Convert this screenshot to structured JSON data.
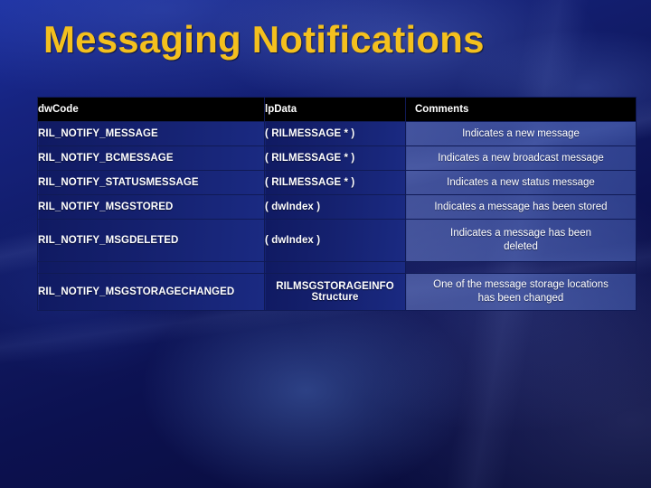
{
  "slide": {
    "title": "Messaging Notifications",
    "title_color": "#f4c01e",
    "background_color": "#0d1057"
  },
  "table": {
    "headers": {
      "col1": "dwCode",
      "col2": "lpData",
      "col3": "Comments"
    },
    "rows": [
      {
        "code": "RIL_NOTIFY_MESSAGE",
        "data": "( RILMESSAGE * )",
        "comment_line1": "Indicates a new message",
        "comment_line2": ""
      },
      {
        "code": "RIL_NOTIFY_BCMESSAGE",
        "data": "( RILMESSAGE * )",
        "comment_line1": "Indicates a new broadcast message",
        "comment_line2": ""
      },
      {
        "code": "RIL_NOTIFY_STATUSMESSAGE",
        "data": "( RILMESSAGE * )",
        "comment_line1": "Indicates a new status message",
        "comment_line2": ""
      },
      {
        "code": "RIL_NOTIFY_MSGSTORED",
        "data": "( dwIndex )",
        "comment_line1": "Indicates a message has been stored",
        "comment_line2": ""
      },
      {
        "code": "RIL_NOTIFY_MSGDELETED",
        "data": "( dwIndex )",
        "comment_line1": "Indicates a message has been",
        "comment_line2": "deleted"
      },
      {
        "code": "RIL_NOTIFY_MSGSTORAGECHANGED",
        "data_line1": "RILMSGSTORAGEINFO",
        "data_line2": "Structure",
        "comment_line1": "One of the message storage locations",
        "comment_line2": "has been changed"
      }
    ]
  }
}
